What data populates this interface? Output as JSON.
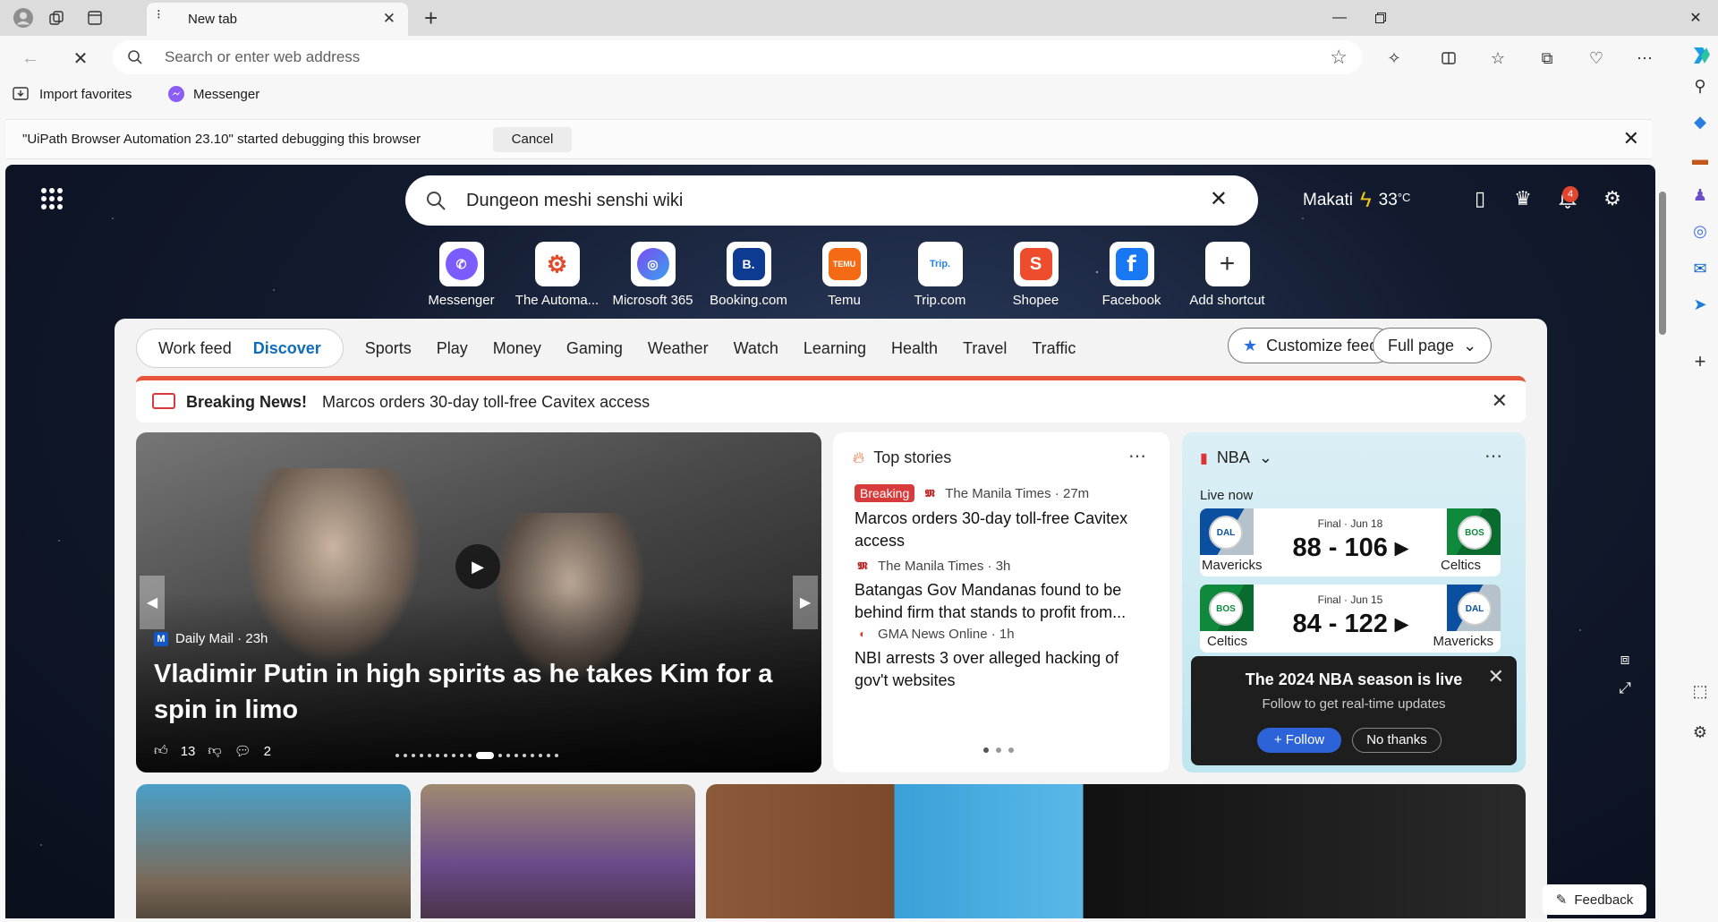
{
  "browser": {
    "tab_title": "New tab",
    "address_placeholder": "Search or enter web address",
    "favorites": [
      {
        "label": "Import favorites",
        "icon": "import-favorites-icon"
      },
      {
        "label": "Messenger",
        "icon": "messenger-icon"
      }
    ],
    "infobar": {
      "message": "\"UiPath Browser Automation 23.10\" started debugging this browser",
      "cancel_label": "Cancel"
    }
  },
  "page": {
    "search_value": "Dungeon meshi senshi wiki",
    "weather": {
      "city": "Makati",
      "temp": "33",
      "unit": "°C",
      "icon": "lightning-icon"
    },
    "notifications_count": "4",
    "shortcuts": [
      {
        "label": "Messenger",
        "color": "#7b5cff",
        "glyph": "✆"
      },
      {
        "label": "The Automa...",
        "color": "#e24a2b",
        "glyph": "⚙"
      },
      {
        "label": "Microsoft 365",
        "color": "#5a6cf0",
        "glyph": "◎"
      },
      {
        "label": "Booking.com",
        "color": "#0c3b91",
        "glyph": "B."
      },
      {
        "label": "Temu",
        "color": "#f56a14",
        "glyph": "TEMU"
      },
      {
        "label": "Trip.com",
        "color": "#2a84e8",
        "glyph": "Trip."
      },
      {
        "label": "Shopee",
        "color": "#ee4d2d",
        "glyph": "S"
      },
      {
        "label": "Facebook",
        "color": "#1877f2",
        "glyph": "f"
      },
      {
        "label": "Add shortcut",
        "color": "#ffffff",
        "glyph": "+"
      }
    ],
    "feed_tabs": {
      "work_feed": "Work feed",
      "discover": "Discover",
      "items": [
        "Sports",
        "Play",
        "Money",
        "Gaming",
        "Weather",
        "Watch",
        "Learning",
        "Health",
        "Travel",
        "Traffic"
      ],
      "customize": "Customize feed",
      "layout": "Full page"
    },
    "breaking": {
      "label": "Breaking News!",
      "text": "Marcos orders 30-day toll-free Cavitex access"
    },
    "hero": {
      "source": "Daily Mail",
      "time": "23h",
      "headline": "Vladimir Putin in high spirits as he takes Kim for a spin in limo",
      "likes": "13",
      "comments": "2"
    },
    "top_stories": {
      "title": "Top stories",
      "items": [
        {
          "badge": "Breaking",
          "source": "The Manila Times",
          "time": "27m",
          "title": "Marcos orders 30-day toll-free Cavitex access"
        },
        {
          "badge": "",
          "source": "The Manila Times",
          "time": "3h",
          "title": "Batangas Gov Mandanas found to be behind firm that stands to profit from..."
        },
        {
          "badge": "",
          "source": "GMA News Online",
          "time": "1h",
          "title": "NBI arrests 3 over alleged hacking of gov't websites"
        }
      ]
    },
    "nba": {
      "title": "NBA",
      "live_label": "Live now",
      "games": [
        {
          "state": "Final · Jun 18",
          "score": "88 - 106",
          "home": "Mavericks",
          "away": "Celtics",
          "home_color": "#0b4fa0",
          "away_color": "#0f8a3c"
        },
        {
          "state": "Final · Jun 15",
          "score": "84 - 122",
          "home": "Celtics",
          "away": "Mavericks",
          "home_color": "#0f8a3c",
          "away_color": "#0b4fa0"
        }
      ],
      "popup": {
        "title": "The 2024 NBA season is live",
        "subtitle": "Follow to get real-time updates",
        "follow": "Follow",
        "dismiss": "No thanks"
      }
    },
    "feedback_label": "Feedback"
  }
}
